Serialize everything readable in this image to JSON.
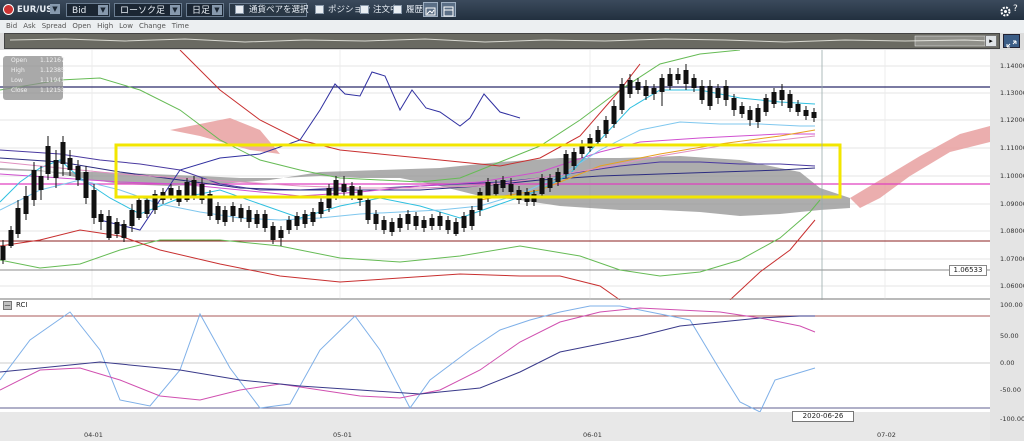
{
  "toolbar": {
    "symbol": "EUR/USD",
    "price_type": "Bid",
    "chart_type": "ローソク足",
    "timeframe": "日足",
    "pair_select_label": "通貨ペアを選択",
    "position_label": "ポジション",
    "orders_label": "注文中",
    "history_label": "履歴"
  },
  "legend": {
    "items": [
      "Bid",
      "Ask",
      "Spread",
      "Open",
      "High",
      "Low",
      "Change",
      "Time"
    ]
  },
  "ohlc": {
    "open_label": "Open",
    "open_value": "1.12167",
    "high_label": "High",
    "high_value": "1.12385",
    "low_label": "Low",
    "low_value": "1.11941",
    "close_label": "Close",
    "close_value": "1.12153"
  },
  "price_axis": {
    "ticks": [
      "1.14000",
      "1.13000",
      "1.12000",
      "1.11000",
      "1.10000",
      "1.09000",
      "1.08000",
      "1.07000",
      "1.06000"
    ],
    "marker_value": "1.06533"
  },
  "rci": {
    "label": "RCI",
    "ticks": [
      "100.00",
      "50.00",
      "0.00",
      "-50.00",
      "-100.00"
    ]
  },
  "time_axis": {
    "ticks": [
      "04-01",
      "05-01",
      "06-01",
      "07-02"
    ],
    "cursor_date": "2020-06-26"
  },
  "colors": {
    "bull": "#d94040",
    "bear": "#111111",
    "highlight": "#f2e600",
    "cloud_gray": "#8a8a8a",
    "cloud_pink": "#e8a0a0"
  }
}
